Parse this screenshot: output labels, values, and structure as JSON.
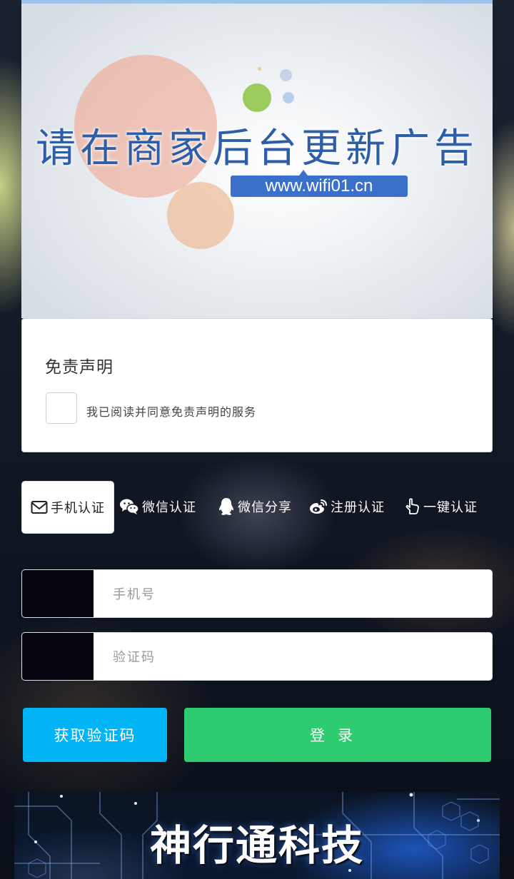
{
  "banner": {
    "title": "请在商家后台更新广告",
    "url": "www.wifi01.cn"
  },
  "disclaimer": {
    "title": "免责声明",
    "agree_text": "我已阅读并同意免责声明的服务",
    "checked": false
  },
  "tabs": [
    {
      "label": "手机认证",
      "icon": "envelope-icon",
      "active": true
    },
    {
      "label": "微信认证",
      "icon": "wechat-icon",
      "active": false
    },
    {
      "label": "微信分享",
      "icon": "qq-icon",
      "active": false
    },
    {
      "label": "注册认证",
      "icon": "weibo-icon",
      "active": false
    },
    {
      "label": "一键认证",
      "icon": "pointer-hand-icon",
      "active": false
    }
  ],
  "form": {
    "phone_placeholder": "手机号",
    "code_placeholder": "验证码",
    "get_code_label": "获取验证码",
    "login_label": "登录"
  },
  "footer": {
    "title": "神行通科技"
  },
  "colors": {
    "get_code_button": "#00b4f5",
    "login_button": "#2ecc71"
  }
}
